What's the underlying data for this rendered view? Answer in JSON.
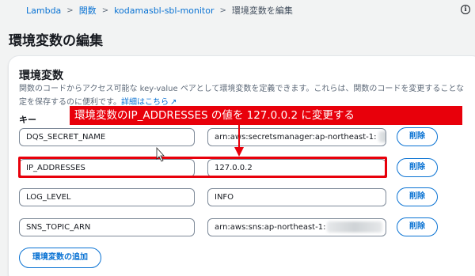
{
  "breadcrumb": {
    "items": [
      "Lambda",
      "関数",
      "kodamasbl-sbl-monitor"
    ],
    "current": "環境変数を編集"
  },
  "icons": {
    "info": "info-icon",
    "separator": "chevron-right-icon",
    "external_link": "external-link-icon",
    "cursor": "mouse-pointer-icon"
  },
  "page": {
    "title": "環境変数の編集"
  },
  "section": {
    "title": "環境変数",
    "description_line1": "関数のコードからアクセス可能な key-value ペアとして環境変数を定義できます。これらは、関数のコードを変更することな",
    "description_line2_prefix": "定を保存するのに便利です。",
    "description_link": "詳細はこちら",
    "key_label": "キー"
  },
  "env_vars": [
    {
      "key": "DQS_SECRET_NAME",
      "value": "arn:aws:secretsmanager:ap-northeast-1:",
      "remove_label": "削除"
    },
    {
      "key": "IP_ADDRESSES",
      "value": "127.0.0.2",
      "remove_label": "削除"
    },
    {
      "key": "LOG_LEVEL",
      "value": "INFO",
      "remove_label": "削除"
    },
    {
      "key": "SNS_TOPIC_ARN",
      "value": "arn:aws:sns:ap-northeast-1:",
      "remove_label": "削除"
    }
  ],
  "add_button": {
    "label": "環境変数の追加"
  },
  "annotation": {
    "text": "環境変数のIP_ADDRESSES の値を 127.0.0.2 に変更する",
    "color": "#e8000b"
  },
  "colors": {
    "accent": "#0972d3",
    "background": "#f2f3f3",
    "panel": "#ffffff"
  }
}
